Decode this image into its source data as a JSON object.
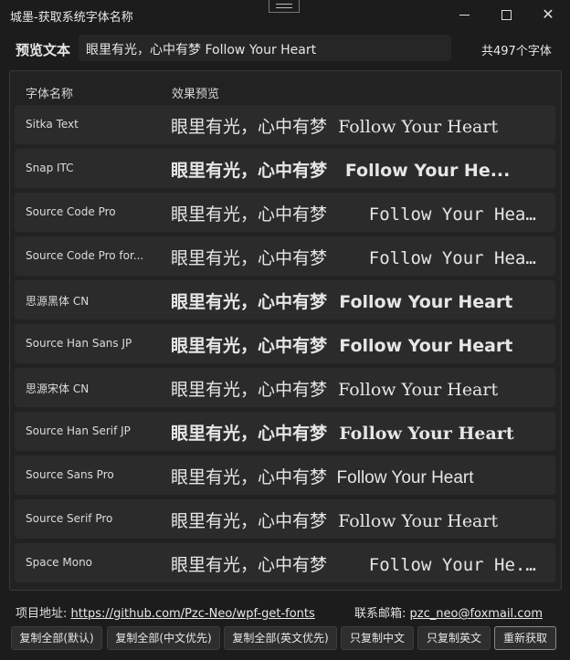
{
  "window": {
    "title": "城墨-获取系统字体名称"
  },
  "preview": {
    "label": "预览文本",
    "text": "眼里有光，心中有梦   Follow Your Heart",
    "count": "共497个字体"
  },
  "list": {
    "header_name": "字体名称",
    "header_preview": "效果预览",
    "rows": [
      {
        "name": "Sitka Text",
        "preview": "眼里有光，心中有梦  Follow Your Heart",
        "style": "serif"
      },
      {
        "name": "Snap ITC",
        "preview": "眼里有光，心中有梦   Follow Your He...",
        "style": "snap"
      },
      {
        "name": "Source Code Pro",
        "preview": "眼里有光，心中有梦    Follow Your Hea...",
        "style": "mono"
      },
      {
        "name": "Source Code Pro for...",
        "preview": "眼里有光，心中有梦    Follow Your Hea...",
        "style": "mono"
      },
      {
        "name": "思源黑体 CN",
        "preview": "眼里有光，心中有梦  Follow Your Heart",
        "style": "sansbold"
      },
      {
        "name": "Source Han Sans JP",
        "preview": "眼里有光，心中有梦  Follow Your Heart",
        "style": "sansheavy"
      },
      {
        "name": "思源宋体 CN",
        "preview": "眼里有光，心中有梦  Follow Your Heart",
        "style": "serif"
      },
      {
        "name": "Source Han Serif JP",
        "preview": "眼里有光，心中有梦  Follow Your Heart",
        "style": "serifbold"
      },
      {
        "name": "Source Sans Pro",
        "preview": "眼里有光，心中有梦  Follow Your Heart",
        "style": "sans"
      },
      {
        "name": "Source Serif Pro",
        "preview": "眼里有光，心中有梦  Follow Your Heart",
        "style": "serif"
      },
      {
        "name": "Space Mono",
        "preview": "眼里有光，心中有梦    Follow Your He...",
        "style": "mono"
      }
    ]
  },
  "footer": {
    "project_label": "项目地址:",
    "project_url": "https://github.com/Pzc-Neo/wpf-get-fonts",
    "email_label": "联系邮箱:",
    "email": "pzc_neo@foxmail.com"
  },
  "buttons": {
    "copy_all_default": "复制全部(默认)",
    "copy_all_cn_first": "复制全部(中文优先)",
    "copy_all_en_first": "复制全部(英文优先)",
    "copy_cn_only": "只复制中文",
    "copy_en_only": "只复制英文",
    "refresh": "重新获取"
  }
}
